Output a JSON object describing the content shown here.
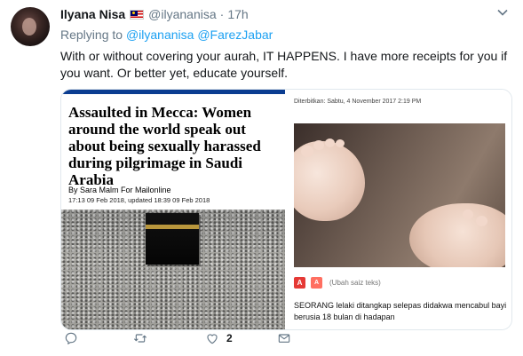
{
  "tweet": {
    "display_name": "Ilyana Nisa",
    "handle": "@ilyananisa",
    "separator": "·",
    "time": "17h",
    "replying_prefix": "Replying to",
    "replying_to": [
      "@ilyananisa",
      "@FarezJabar"
    ],
    "text": "With or without covering your aurah, IT HAPPENS. I have more receipts for you if you want. Or better yet, educate yourself."
  },
  "media_left": {
    "headline": "Assaulted in Mecca: Women around the world speak out about being sexually harassed during pilgrimage in Saudi Arabia",
    "byline_prefix": "By",
    "author": "Sara Malm For Mailonline",
    "dates": "17:13 09 Feb 2018, updated 18:39 09 Feb 2018"
  },
  "media_right": {
    "meta": "Diterbitkan: Sabtu, 4 November 2017 2:19 PM",
    "icon_a_large": "A",
    "icon_a_small": "A",
    "resize_label": "(Ubah saiz teks)",
    "paragraph": "SEORANG lelaki ditangkap selepas didakwa mencabul bayi berusia 18 bulan di hadapan"
  },
  "actions": {
    "like_count": "2"
  },
  "icons": {
    "caret": "chevron-down-icon",
    "reply": "reply-icon",
    "retweet": "retweet-icon",
    "like": "heart-icon",
    "dm": "envelope-icon"
  },
  "colors": {
    "link": "#1da1f2",
    "muted": "#657786",
    "text": "#14171a",
    "flag_red": "#cc0001",
    "flag_blue": "#010066",
    "article_bar": "#0b3d91",
    "text_size_icon": "#e53935"
  }
}
